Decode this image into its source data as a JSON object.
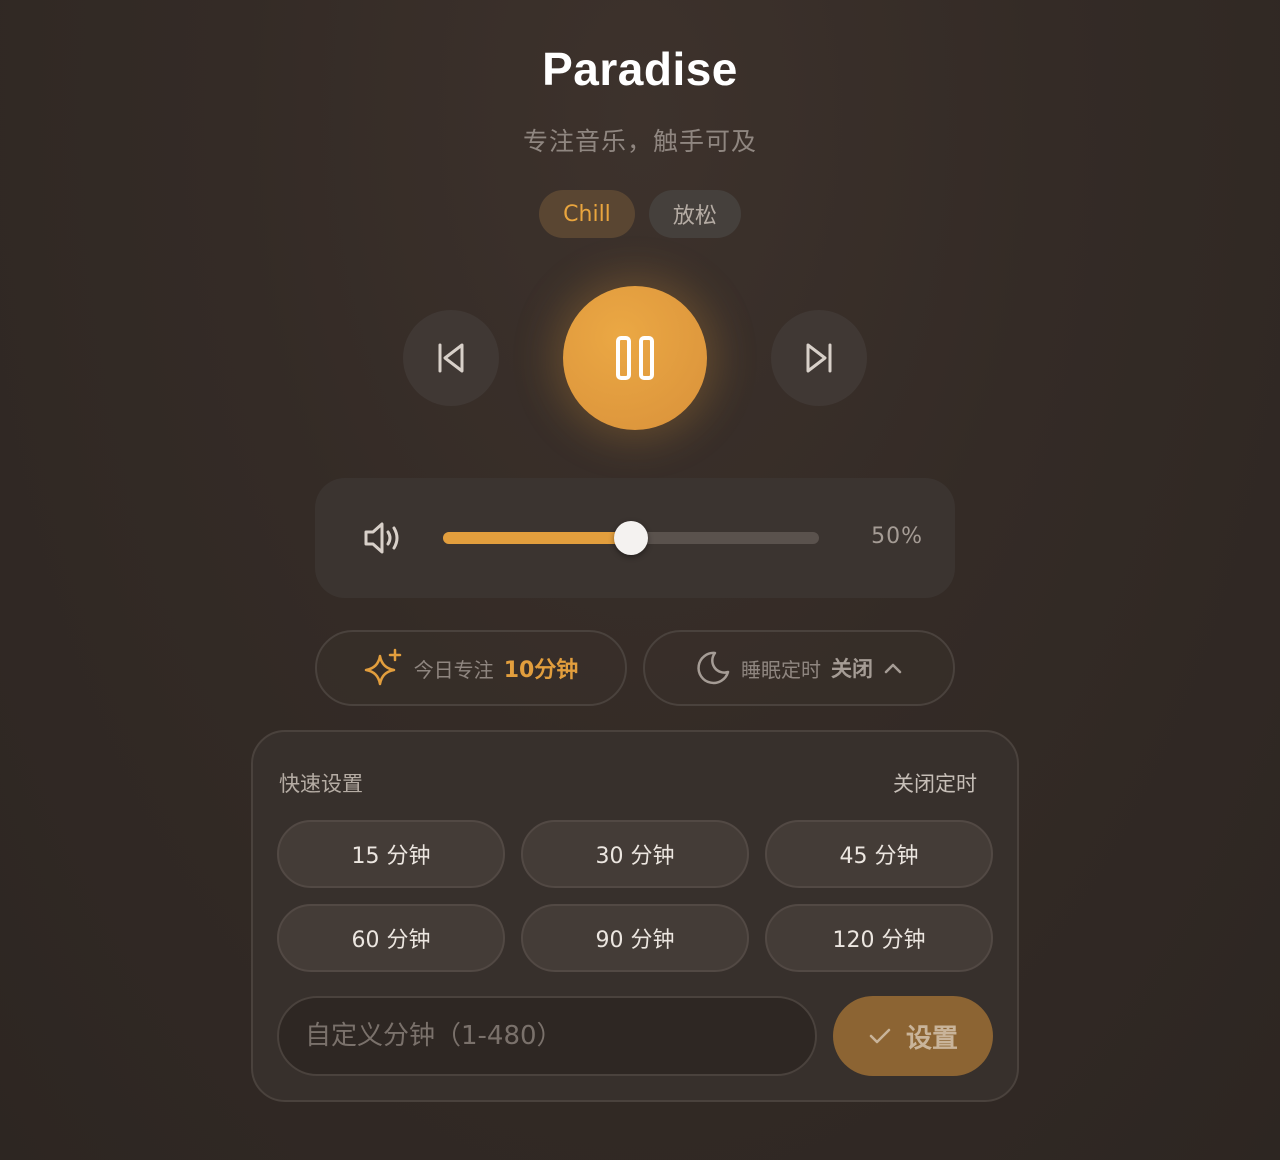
{
  "header": {
    "title": "Paradise",
    "subtitle": "专注音乐，触手可及"
  },
  "tags": [
    {
      "label": "Chill",
      "active": true
    },
    {
      "label": "放松",
      "active": false
    }
  ],
  "player": {
    "state": "playing",
    "prev_icon": "skip-previous-icon",
    "play_icon": "pause-icon",
    "next_icon": "skip-next-icon"
  },
  "volume": {
    "icon": "speaker-icon",
    "level_percent": 50,
    "label": "50%"
  },
  "focus": {
    "icon": "sparkle-icon",
    "label": "今日专注",
    "value": "10分钟"
  },
  "sleep_timer": {
    "icon": "moon-icon",
    "label": "睡眠定时",
    "value": "关闭",
    "expanded": true
  },
  "timer_panel": {
    "heading": "快速设置",
    "off_label": "关闭定时",
    "options": [
      "15 分钟",
      "30 分钟",
      "45 分钟",
      "60 分钟",
      "90 分钟",
      "120 分钟"
    ],
    "custom_placeholder": "自定义分钟（1-480）",
    "set_label": "设置"
  },
  "colors": {
    "accent": "#e29e3d",
    "background": "#342b26"
  }
}
